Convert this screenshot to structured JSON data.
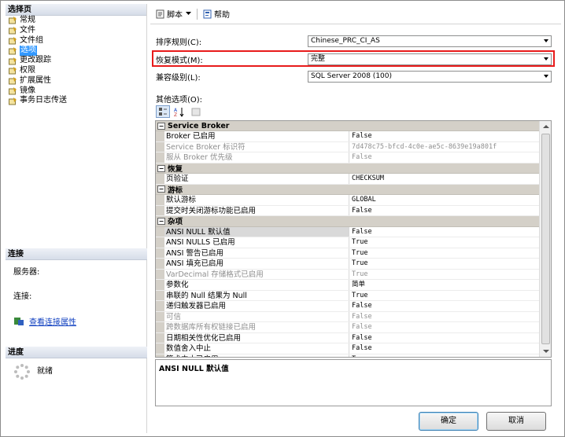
{
  "left": {
    "select_page_title": "选择页",
    "nav": [
      {
        "label": "常规",
        "selected": false
      },
      {
        "label": "文件",
        "selected": false
      },
      {
        "label": "文件组",
        "selected": false
      },
      {
        "label": "选项",
        "selected": true
      },
      {
        "label": "更改跟踪",
        "selected": false
      },
      {
        "label": "权限",
        "selected": false
      },
      {
        "label": "扩展属性",
        "selected": false
      },
      {
        "label": "镜像",
        "selected": false
      },
      {
        "label": "事务日志传送",
        "selected": false
      }
    ],
    "connection_title": "连接",
    "server_label": "服务器:",
    "connection_label": "连接:",
    "view_conn_props": "查看连接属性",
    "progress_title": "进度",
    "progress_status": "就绪"
  },
  "toolbar": {
    "script_label": "脚本",
    "help_label": "帮助"
  },
  "fields": {
    "collation_label": "排序规则(C):",
    "collation_value": "Chinese_PRC_CI_AS",
    "recovery_label": "恢复模式(M):",
    "recovery_value": "完整",
    "compat_label": "兼容级别(L):",
    "compat_value": "SQL Server 2008 (100)",
    "other_options_label": "其他选项(O):"
  },
  "grid": {
    "categories": [
      {
        "name": "Service Broker",
        "rows": [
          {
            "name": "Broker 已启用",
            "value": "False",
            "disabled": false
          },
          {
            "name": "Service Broker 标识符",
            "value": "7d478c75-bfcd-4c0e-ae5c-8639e19a801f",
            "disabled": true
          },
          {
            "name": "服从 Broker 优先级",
            "value": "False",
            "disabled": true
          }
        ]
      },
      {
        "name": "恢复",
        "rows": [
          {
            "name": "页验证",
            "value": "CHECKSUM",
            "disabled": false
          }
        ]
      },
      {
        "name": "游标",
        "rows": [
          {
            "name": "默认游标",
            "value": "GLOBAL",
            "disabled": false
          },
          {
            "name": "提交时关闭游标功能已启用",
            "value": "False",
            "disabled": false
          }
        ]
      },
      {
        "name": "杂项",
        "rows": [
          {
            "name": "ANSI NULL 默认值",
            "value": "False",
            "disabled": false,
            "selected": true
          },
          {
            "name": "ANSI NULLS 已启用",
            "value": "True",
            "disabled": false
          },
          {
            "name": "ANSI 警告已启用",
            "value": "True",
            "disabled": false
          },
          {
            "name": "ANSI 填充已启用",
            "value": "True",
            "disabled": false
          },
          {
            "name": "VarDecimal 存储格式已启用",
            "value": "True",
            "disabled": true
          },
          {
            "name": "参数化",
            "value": "简单",
            "disabled": false
          },
          {
            "name": "串联的 Null 结果为 Null",
            "value": "True",
            "disabled": false
          },
          {
            "name": "递归触发器已启用",
            "value": "False",
            "disabled": false
          },
          {
            "name": "可信",
            "value": "False",
            "disabled": true
          },
          {
            "name": "跨数据库所有权链接已启用",
            "value": "False",
            "disabled": true
          },
          {
            "name": "日期相关性优化已启用",
            "value": "False",
            "disabled": false
          },
          {
            "name": "数值舍入中止",
            "value": "False",
            "disabled": false
          },
          {
            "name": "算术中止已启用",
            "value": "True",
            "disabled": false
          }
        ]
      }
    ]
  },
  "description": "ANSI NULL 默认值",
  "buttons": {
    "ok": "确定",
    "cancel": "取消"
  },
  "colors": {
    "selection": "#3399ff",
    "highlight_border": "#e81b1b",
    "category_bg": "#d4d0c8"
  }
}
